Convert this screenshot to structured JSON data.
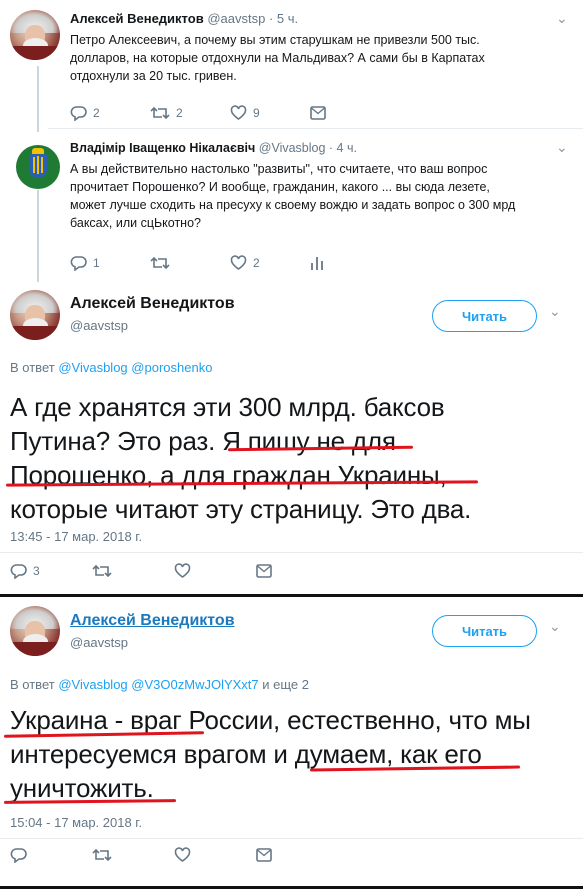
{
  "tweet1": {
    "name": "Алексей Венедиктов",
    "handle": "@aavstsp",
    "time": "· 5 ч.",
    "text_l1": "Петро Алексеевич, а почему вы этим старушкам не привезли 500 тыс.",
    "text_l2": "долларов, на которые отдохнули на Мальдивах? А сами бы в Карпатах",
    "text_l3": "отдохнули за 20 тыс. гривен.",
    "replies": "2",
    "retweets": "2",
    "likes": "9"
  },
  "tweet2": {
    "name": "Владімір Іващенко Нікалаєвіч",
    "handle": "@Vivasblog",
    "time": "· 4 ч.",
    "text_l1": "А вы действительно настолько \"развиты\", что считаете, что ваш вопрос",
    "text_l2": "прочитает Порошенко? И вообще, гражданин, какого ... вы сюда лезете,",
    "text_l3": "может лучше сходить на пресуху к своему вождю и задать вопрос о 300 мрд",
    "text_l4": "баксах, или сцЬкотно?",
    "replies": "1",
    "retweets": "",
    "likes": "2"
  },
  "tweet3": {
    "name": "Алексей Венедиктов",
    "handle": "@aavstsp",
    "follow_label": "Читать",
    "reply_prefix": "В ответ",
    "reply_user1": "@Vivasblog",
    "reply_user2": "@poroshenko",
    "text_l1": "А где хранятся эти 300 млрд. баксов",
    "text_l2": "Путина? Это раз. Я пишу не для",
    "text_l3": "Порошенко, а для граждан Украины,",
    "text_l4": "которые читают эту страницу. Это два.",
    "timestamp": "13:45 - 17 мар. 2018 г.",
    "replies": "3"
  },
  "tweet4": {
    "name": "Алексей Венедиктов",
    "handle": "@aavstsp",
    "follow_label": "Читать",
    "reply_prefix": "В ответ",
    "reply_user1": "@Vivasblog",
    "reply_user2": "@V3O0zMwJOlYXxt7",
    "reply_suffix": "и еще 2",
    "text_l1": "Украина - враг России, естественно, что мы",
    "text_l2": "интересуемся врагом и думаем, как его",
    "text_l3": "уничтожить.",
    "timestamp": "15:04 - 17 мар. 2018 г."
  },
  "colors": {
    "accent": "#1da1f2",
    "muted": "#657786",
    "underline": "#e0141f"
  }
}
